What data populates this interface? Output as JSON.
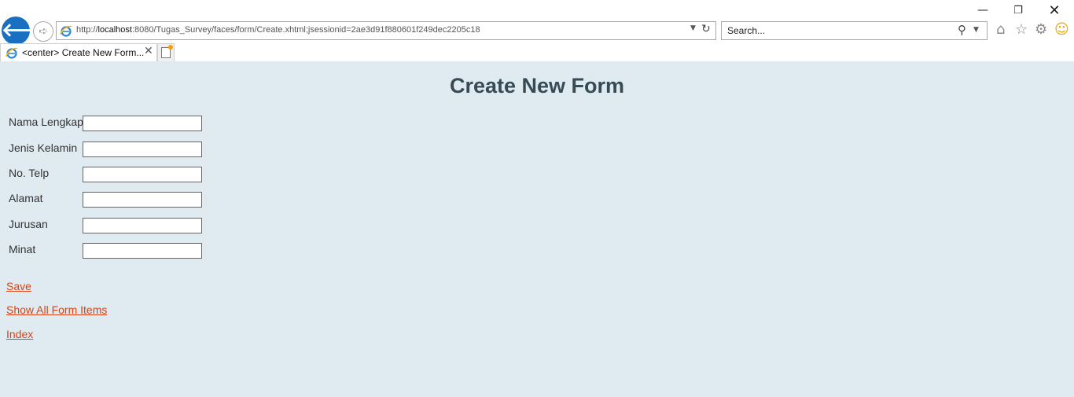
{
  "window": {
    "minimize_glyph": "—",
    "maximize_glyph": "❐",
    "close_glyph": "✕"
  },
  "navigation": {
    "back_icon": "back-arrow-icon",
    "forward_icon": "forward-arrow-icon",
    "address": {
      "scheme": "http://",
      "host": "localhost",
      "path": ":8080/Tugas_Survey/faces/form/Create.xhtml;jsessionid=2ae3d91f880601f249dec2205c18"
    },
    "search": {
      "value": "Search..."
    }
  },
  "tabs": [
    {
      "title": "<center> Create New Form...",
      "active": true
    }
  ],
  "toolbar_icons": [
    "home-icon",
    "favorites-star-icon",
    "settings-gear-icon",
    "feedback-smiley-icon"
  ],
  "colors": {
    "page_background": "#dfebf1",
    "title": "#374b54",
    "link": "#d84315",
    "back_button": "#1b6fc0"
  },
  "form": {
    "title": "Create New Form",
    "fields": [
      {
        "label": "Nama Lengkap",
        "value": ""
      },
      {
        "label": "Jenis Kelamin",
        "value": ""
      },
      {
        "label": "No. Telp",
        "value": ""
      },
      {
        "label": "Alamat",
        "value": ""
      },
      {
        "label": "Jurusan",
        "value": ""
      },
      {
        "label": "Minat",
        "value": ""
      }
    ]
  },
  "links": {
    "save": "Save",
    "show_all": "Show All Form Items",
    "index": "Index"
  }
}
